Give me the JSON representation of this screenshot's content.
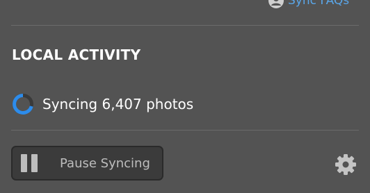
{
  "header": {
    "faq_link": "Sync FAQs",
    "faq_icon": "user-icon"
  },
  "local_activity": {
    "title": "LOCAL ACTIVITY",
    "status_text": "Syncing 6,407 photos",
    "status_icon": "progress-spinner-icon",
    "accent_color": "#2d8ceb"
  },
  "controls": {
    "pause_label": "Pause Syncing",
    "pause_icon": "pause-icon",
    "settings_icon": "gear-icon"
  }
}
